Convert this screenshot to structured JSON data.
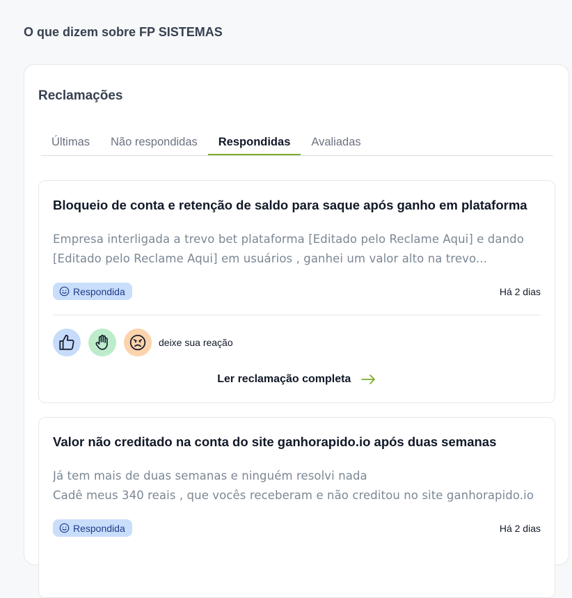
{
  "page": {
    "heading": "O que dizem sobre FP SISTEMAS"
  },
  "panel": {
    "title": "Reclamações",
    "tabs": [
      "Últimas",
      "Não respondidas",
      "Respondidas",
      "Avaliadas"
    ],
    "active_tab": "Respondidas"
  },
  "complaints": [
    {
      "title": "Bloqueio de conta e retenção de saldo para saque após ganho em plataforma",
      "desc_line1": "Empresa interligada a trevo bet plataforma [Editado pelo Reclame Aqui] e dando",
      "desc_line2": "[Editado pelo Reclame Aqui] em usuários , ganhei um valor alto na trevo...",
      "status": "Respondida",
      "time": "Há 2 dias",
      "reaction_prompt": "deixe sua reação",
      "read_more": "Ler reclamação completa"
    },
    {
      "title": "Valor não creditado na conta do site ganhorapido.io após duas semanas",
      "desc_line1": "Já tem mais de duas semanas e ninguém resolvi nada",
      "desc_line2": "Cadê meus 340 reais , que vocês receberam e não creditou no site ganhorapido.io",
      "status": "Respondida",
      "time": "Há 2 dias"
    }
  ],
  "colors": {
    "accent": "#7fab2a",
    "badge_bg": "#c9defb",
    "like_bg": "#c7dbfa",
    "hand_bg": "#bdeccb",
    "angry_bg": "#fbd3ac"
  },
  "icons": [
    "smile-icon",
    "thumbs-up-icon",
    "raised-hand-icon",
    "angry-face-icon",
    "arrow-right-icon"
  ]
}
